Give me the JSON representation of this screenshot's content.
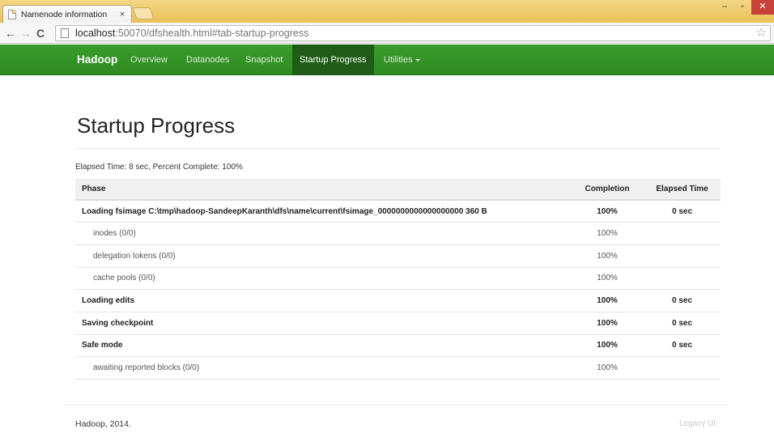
{
  "browser": {
    "tab_title": "Namenode information",
    "tab_close": "×",
    "url_host": "localhost",
    "url_rest": ":50070/dfshealth.html#tab-startup-progress",
    "back_glyph": "←",
    "forward_glyph": "→",
    "reload_glyph": "C",
    "star_glyph": "☆",
    "minimize_glyph": "–",
    "restore_glyph": "▫",
    "close_glyph": "✕"
  },
  "navbar": {
    "brand": "Hadoop",
    "items": [
      {
        "label": "Overview"
      },
      {
        "label": "Datanodes"
      },
      {
        "label": "Snapshot"
      },
      {
        "label": "Startup Progress"
      },
      {
        "label": "Utilities"
      }
    ],
    "active_item": "Startup Progress",
    "colors": {
      "bar": "#3b9c2c",
      "active": "#1f5c17"
    }
  },
  "page": {
    "title": "Startup Progress",
    "summary": "Elapsed Time: 8 sec, Percent Complete: 100%"
  },
  "table": {
    "headers": {
      "phase": "Phase",
      "completion": "Completion",
      "elapsed": "Elapsed Time"
    },
    "rows": [
      {
        "phase": "Loading fsimage C:\\tmp\\hadoop-SandeepKaranth\\dfs\\name\\current\\fsimage_0000000000000000000 360 B",
        "completion": "100%",
        "elapsed": "0 sec"
      },
      {
        "phase": "inodes (0/0)",
        "completion": "100%",
        "elapsed": ""
      },
      {
        "phase": "delegation tokens (0/0)",
        "completion": "100%",
        "elapsed": ""
      },
      {
        "phase": "cache pools (0/0)",
        "completion": "100%",
        "elapsed": ""
      },
      {
        "phase": "Loading edits",
        "completion": "100%",
        "elapsed": "0 sec"
      },
      {
        "phase": "Saving checkpoint",
        "completion": "100%",
        "elapsed": "0 sec"
      },
      {
        "phase": "Safe mode",
        "completion": "100%",
        "elapsed": "0 sec"
      },
      {
        "phase": "awaiting reported blocks (0/0)",
        "completion": "100%",
        "elapsed": ""
      }
    ]
  },
  "footer": {
    "left": "Hadoop, 2014.",
    "right": "Legacy UI"
  }
}
